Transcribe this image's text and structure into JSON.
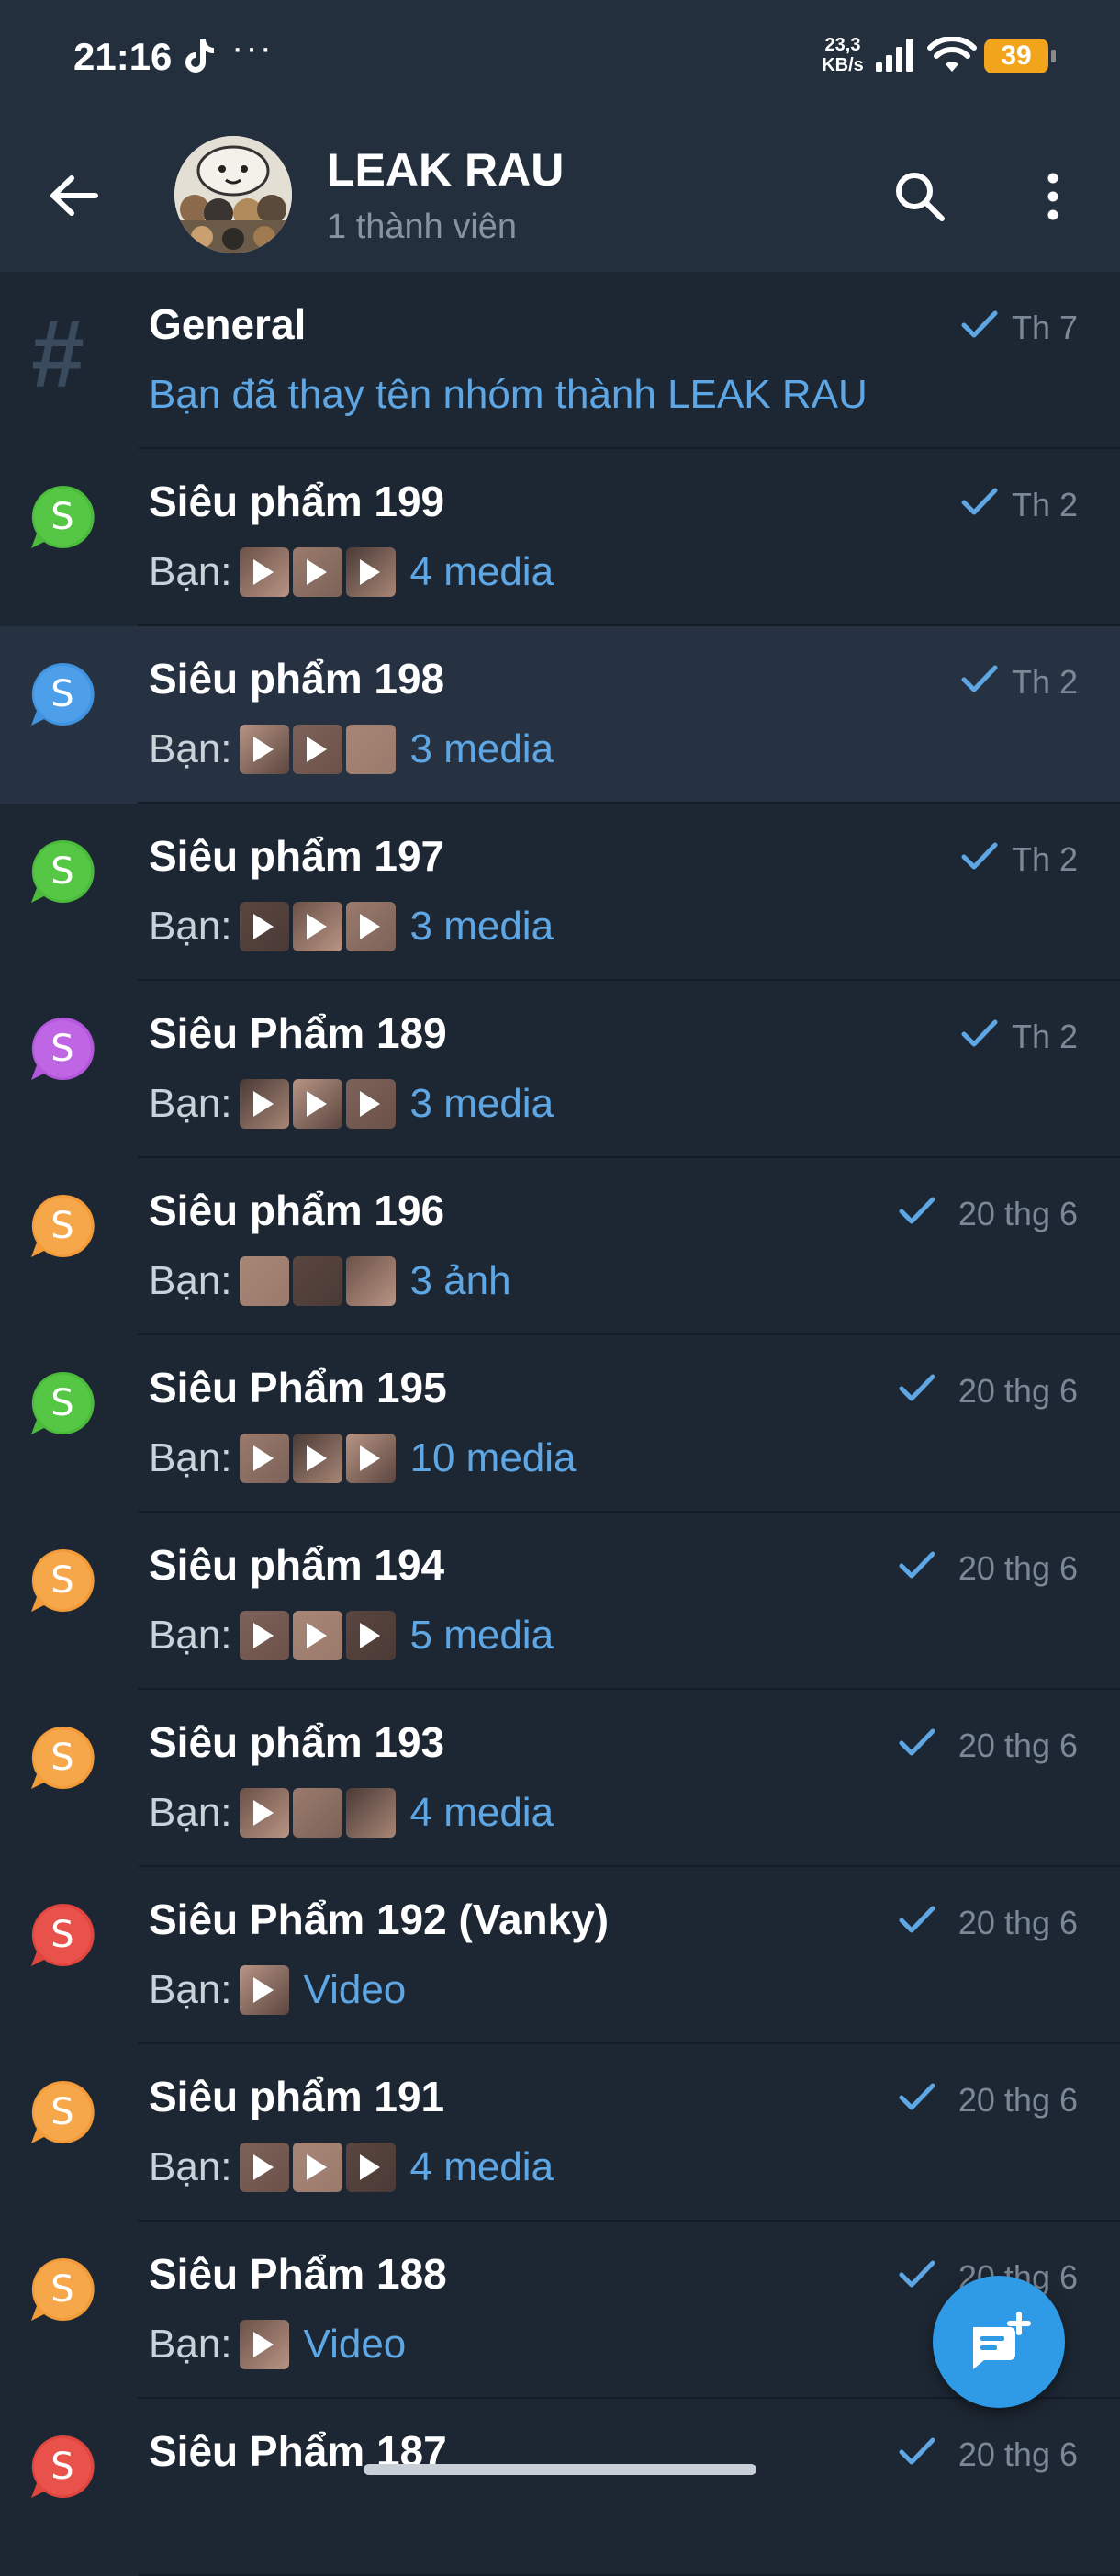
{
  "status_bar": {
    "time": "21:16",
    "dots": "···",
    "net_speed_value": "23,3",
    "net_speed_unit": "KB/s",
    "battery": "39",
    "icons": [
      "tiktok-icon",
      "signal-icon",
      "wifi-icon",
      "battery-icon"
    ]
  },
  "header": {
    "title": "LEAK RAU",
    "subtitle": "1 thành viên",
    "icons": [
      "back-arrow-icon",
      "search-icon",
      "more-vertical-icon"
    ]
  },
  "colors": {
    "background": "#1d2733",
    "header": "#242f3d",
    "accent": "#5ea7e4",
    "check": "#5ea7e4",
    "green": "#4cbb3c",
    "blue": "#3f93e0",
    "purple": "#b457dd",
    "orange": "#f29b38",
    "red": "#e0463d"
  },
  "topics": [
    {
      "title": "General",
      "date": "Th 7",
      "sender": "",
      "preview": "Bạn đã thay tên nhóm thành LEAK RAU",
      "icon": "hash-icon",
      "color": "hash",
      "thumbs": []
    },
    {
      "title": "Siêu phẩm 199",
      "date": "Th 2",
      "sender": "Bạn:",
      "preview": "4 media",
      "icon": "speech-bubble-icon",
      "letter": "S",
      "color": "green",
      "thumbs": [
        "video",
        "video",
        "video"
      ]
    },
    {
      "title": "Siêu phẩm 198",
      "date": "Th 2",
      "sender": "Bạn:",
      "preview": "3 media",
      "icon": "speech-bubble-icon",
      "letter": "S",
      "color": "blue",
      "thumbs": [
        "video",
        "video",
        "image"
      ]
    },
    {
      "title": "Siêu phẩm 197",
      "date": "Th 2",
      "sender": "Bạn:",
      "preview": "3 media",
      "icon": "speech-bubble-icon",
      "letter": "S",
      "color": "green",
      "thumbs": [
        "video",
        "video",
        "video"
      ]
    },
    {
      "title": "Siêu Phẩm 189",
      "date": "Th 2",
      "sender": "Bạn:",
      "preview": "3 media",
      "icon": "speech-bubble-icon",
      "letter": "S",
      "color": "purple",
      "thumbs": [
        "video",
        "video",
        "video"
      ]
    },
    {
      "title": "Siêu phẩm 196",
      "date": "20 thg 6",
      "sender": "Bạn:",
      "preview": "3 ảnh",
      "icon": "speech-bubble-icon",
      "letter": "S",
      "color": "orange",
      "thumbs": [
        "image",
        "image",
        "image"
      ]
    },
    {
      "title": "Siêu Phẩm 195",
      "date": "20 thg 6",
      "sender": "Bạn:",
      "preview": "10 media",
      "icon": "speech-bubble-icon",
      "letter": "S",
      "color": "green",
      "thumbs": [
        "video",
        "video",
        "video"
      ]
    },
    {
      "title": "Siêu phẩm 194",
      "date": "20 thg 6",
      "sender": "Bạn:",
      "preview": "5 media",
      "icon": "speech-bubble-icon",
      "letter": "S",
      "color": "orange",
      "thumbs": [
        "video",
        "video",
        "video"
      ]
    },
    {
      "title": "Siêu phẩm 193",
      "date": "20 thg 6",
      "sender": "Bạn:",
      "preview": "4 media",
      "icon": "speech-bubble-icon",
      "letter": "S",
      "color": "orange",
      "thumbs": [
        "video",
        "image",
        "image"
      ]
    },
    {
      "title": "Siêu Phẩm 192 (Vanky)",
      "date": "20 thg 6",
      "sender": "Bạn:",
      "preview": "Video",
      "icon": "speech-bubble-icon",
      "letter": "S",
      "color": "red",
      "thumbs": [
        "video"
      ]
    },
    {
      "title": "Siêu phẩm 191",
      "date": "20 thg 6",
      "sender": "Bạn:",
      "preview": "4 media",
      "icon": "speech-bubble-icon",
      "letter": "S",
      "color": "orange",
      "thumbs": [
        "video",
        "video",
        "video"
      ]
    },
    {
      "title": "Siêu Phẩm 188",
      "date": "20 thg 6",
      "sender": "Bạn:",
      "preview": "Video",
      "icon": "speech-bubble-icon",
      "letter": "S",
      "color": "orange",
      "thumbs": [
        "video"
      ]
    },
    {
      "title": "Siêu Phẩm 187",
      "date": "20 thg 6",
      "sender": "",
      "preview": "",
      "icon": "speech-bubble-icon",
      "letter": "S",
      "color": "red",
      "thumbs": []
    }
  ],
  "fab": {
    "icon": "new-message-icon"
  }
}
